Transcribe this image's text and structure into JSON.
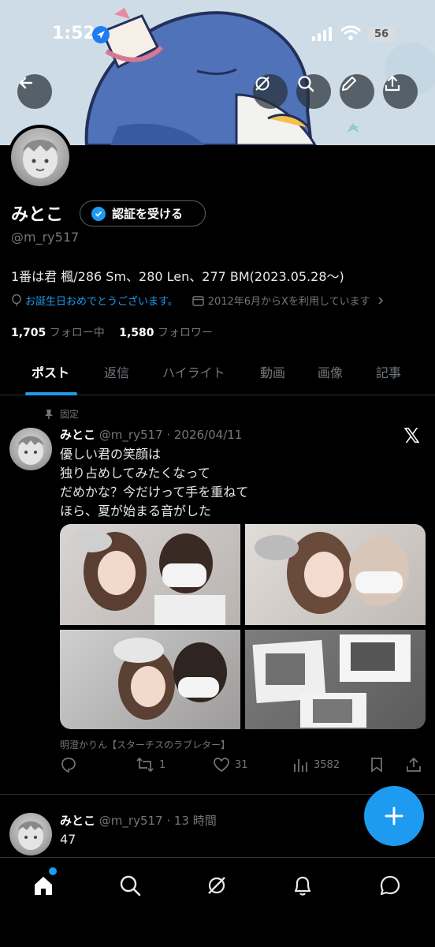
{
  "status_bar": {
    "time": "1:52",
    "battery": "56"
  },
  "profile": {
    "name": "みとこ",
    "verify_label": "認証を受ける",
    "handle": "@m_ry517",
    "bio": "1番は君 楓/286 Sm、280 Len、277 BM(2023.05.28～)",
    "birthday": "お誕生日おめでとうございます。",
    "joined": "2012年6月からXを利用しています",
    "following_count": "1,705",
    "following_label": "フォロー中",
    "followers_count": "1,580",
    "followers_label": "フォロワー"
  },
  "tabs": [
    "ポスト",
    "返信",
    "ハイライト",
    "動画",
    "画像",
    "記事"
  ],
  "pinned_post": {
    "pinned_label": "固定",
    "name": "みとこ",
    "handle_date": "@m_ry517 · 2026/04/11",
    "lines": [
      "優しい君の笑顔は",
      "独り占めしてみたくなって",
      "だめかな？今だけって手を重ねて",
      "ほら、夏が始まる音がした"
    ],
    "caption": "明澄かりん【スターチスのラブレター】",
    "retweets": "1",
    "likes": "31",
    "views": "3582"
  },
  "second_post": {
    "name": "みとこ",
    "handle_time": "@m_ry517 · 13 時間",
    "text": "47"
  },
  "colors": {
    "accent": "#1d9bf0",
    "background": "#000000",
    "muted": "#71767b"
  },
  "icons": {
    "back": "back-arrow-icon",
    "grok": "grok-icon",
    "search": "search-icon",
    "edit": "pen-icon",
    "share": "share-icon",
    "nav": [
      "home-icon",
      "search-icon",
      "grok-icon",
      "bell-icon",
      "message-icon"
    ]
  }
}
